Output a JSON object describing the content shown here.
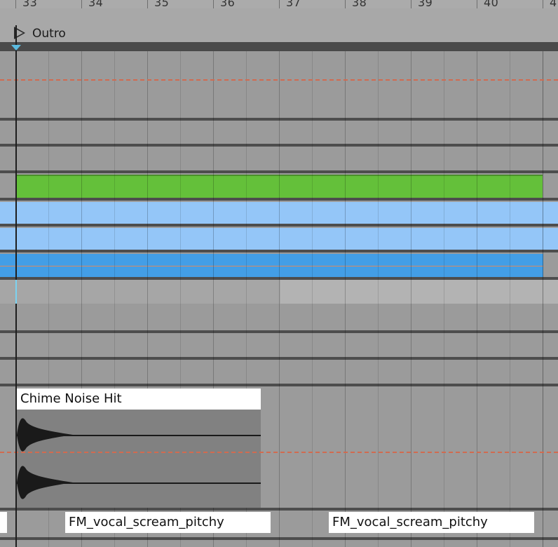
{
  "ruler": {
    "bars": [
      "33",
      "34",
      "35",
      "36",
      "37",
      "38",
      "39",
      "40",
      "4"
    ]
  },
  "locator": {
    "label": "Outro"
  },
  "clips": {
    "chime": {
      "name": "Chime Noise Hit"
    },
    "fm_clips": [
      {
        "name": "FM_vocal_scream_pitchy"
      },
      {
        "name": "FM_vocal_scream_pitchy"
      }
    ]
  },
  "colors": {
    "green_clip": "#64c03a",
    "light_blue_clip": "#94c6f8",
    "blue_clip": "#439ee6",
    "playhead_marker": "#5bbbe0",
    "automation_dash": "#d16b50"
  }
}
